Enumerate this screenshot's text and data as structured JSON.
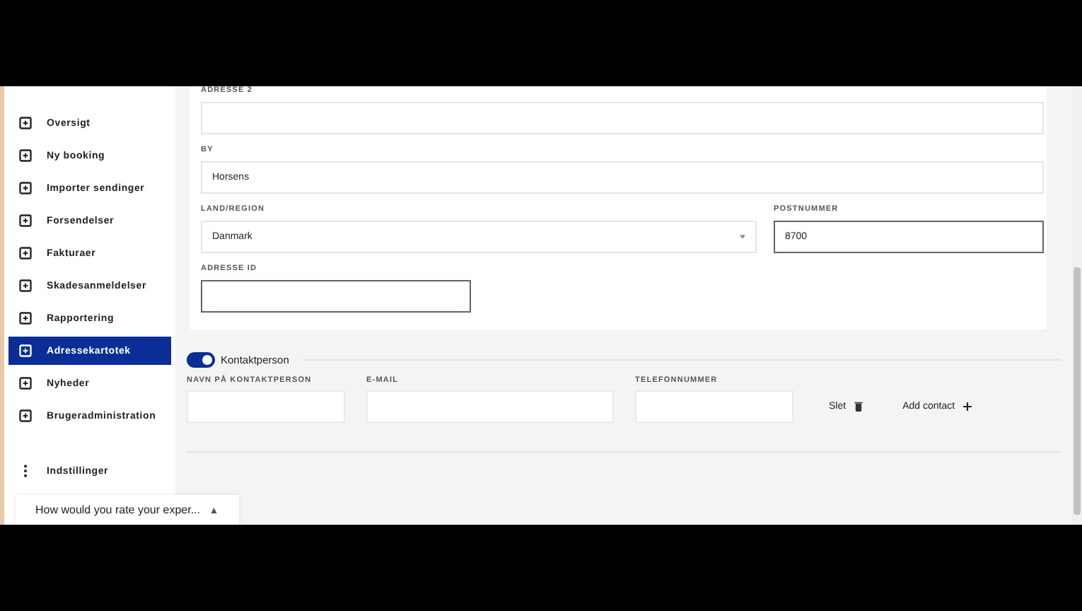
{
  "sidebar": {
    "items": [
      {
        "label": "Oversigt",
        "selected": false
      },
      {
        "label": "Ny booking",
        "selected": false
      },
      {
        "label": "Importer sendinger",
        "selected": false
      },
      {
        "label": "Forsendelser",
        "selected": false
      },
      {
        "label": "Fakturaer",
        "selected": false
      },
      {
        "label": "Skadesanmeldelser",
        "selected": false
      },
      {
        "label": "Rapportering",
        "selected": false
      },
      {
        "label": "Adressekartotek",
        "selected": true
      },
      {
        "label": "Nyheder",
        "selected": false
      },
      {
        "label": "Brugeradministration",
        "selected": false
      }
    ],
    "settings": "Indstillinger"
  },
  "feedback": {
    "text": "How would you rate your exper...",
    "arrow": "▲"
  },
  "address_form": {
    "fields": [
      {
        "label": "ADRESSE 2",
        "kind": "text",
        "focused": false
      },
      {
        "label": "BY",
        "value": "Horsens",
        "kind": "text",
        "focused": false
      },
      {
        "label": "LAND/REGION",
        "value": "Danmark",
        "kind": "select",
        "focused": false
      },
      {
        "label": "POSTNUMMER",
        "value": "8700",
        "kind": "text",
        "focused": true
      },
      {
        "label": "ADRESSE ID",
        "kind": "text",
        "focused": true
      }
    ]
  },
  "contact": {
    "toggle_label": "Kontaktperson",
    "on": true,
    "fields": [
      {
        "label": "NAVN PÅ KONTAKTPERSON"
      },
      {
        "label": "E-MAIL"
      },
      {
        "label": "TELEFONNUMMER"
      }
    ],
    "delete_label": "Slet",
    "add_label": "Add contact"
  }
}
